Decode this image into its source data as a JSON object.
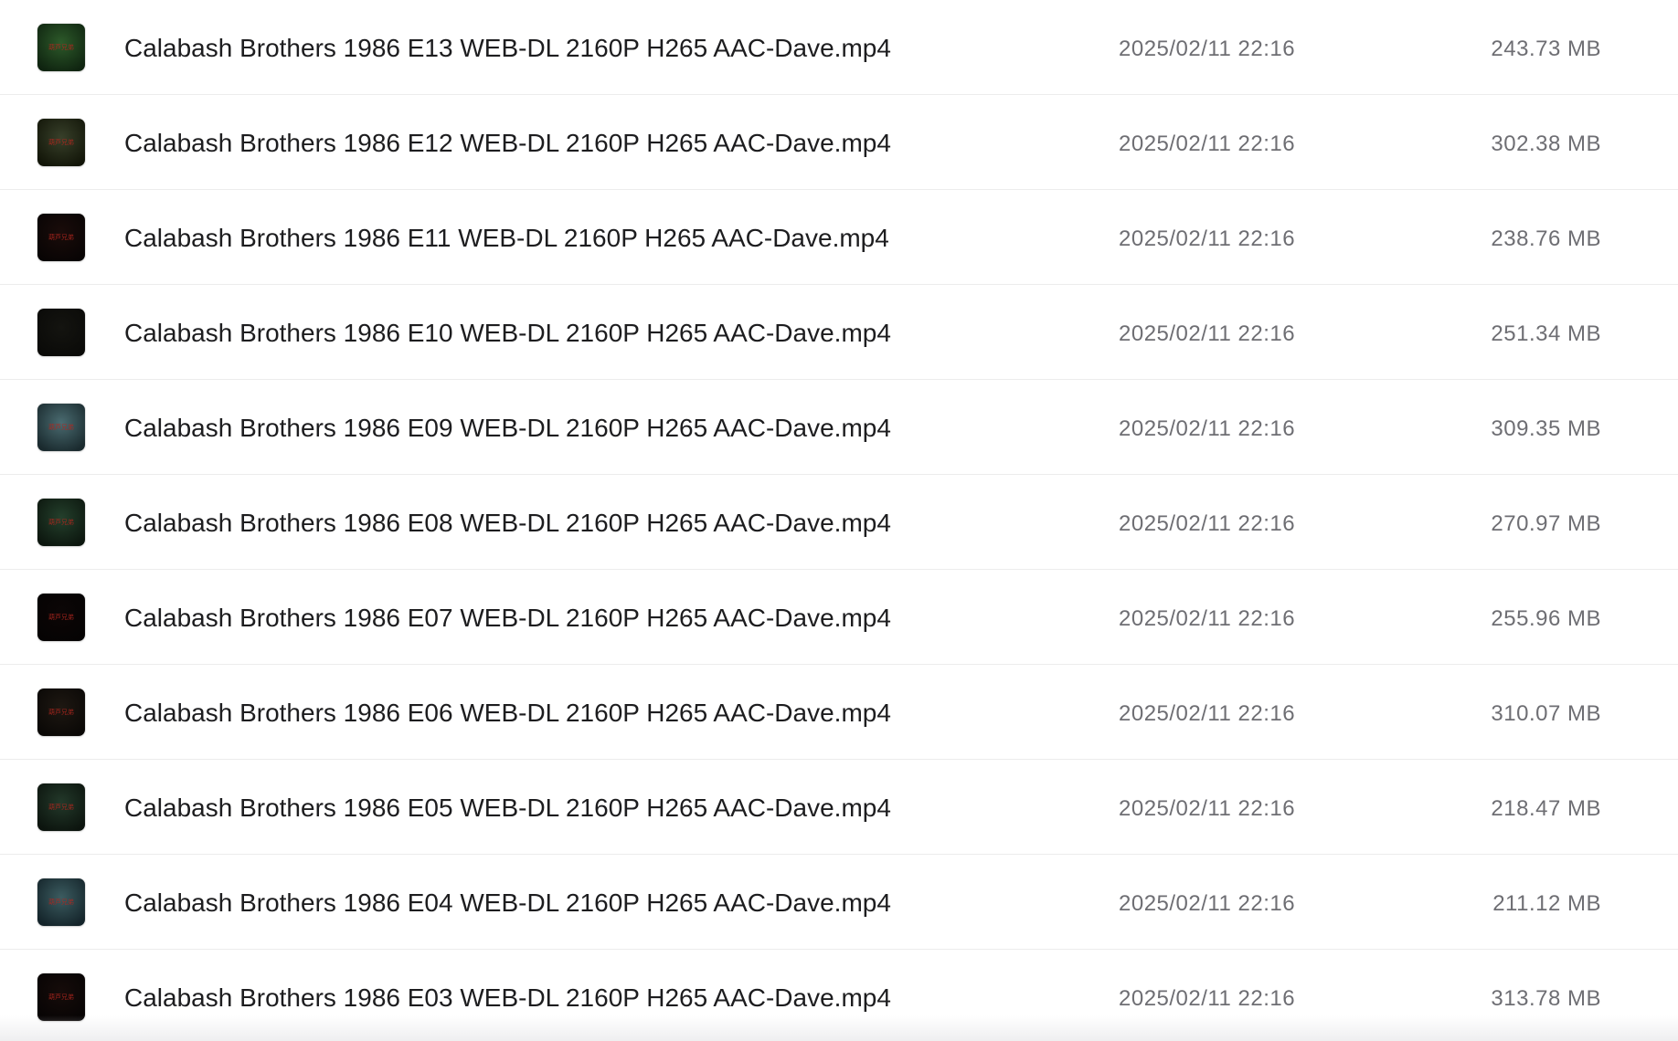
{
  "files": [
    {
      "name": "Calabash Brothers 1986 E13 WEB-DL 2160P H265 AAC-Dave.mp4",
      "date": "2025/02/11 22:16",
      "size": "243.73 MB",
      "thumb_colors": [
        "#2d5a2a",
        "#0f2410"
      ],
      "thumb_caption": "葫芦兄弟",
      "thumb_icon": "video-thumbnail-icon"
    },
    {
      "name": "Calabash Brothers 1986 E12 WEB-DL 2160P H265 AAC-Dave.mp4",
      "date": "2025/02/11 22:16",
      "size": "302.38 MB",
      "thumb_colors": [
        "#38402a",
        "#121508"
      ],
      "thumb_caption": "葫芦兄弟",
      "thumb_icon": "video-thumbnail-icon"
    },
    {
      "name": "Calabash Brothers 1986 E11 WEB-DL 2160P H265 AAC-Dave.mp4",
      "date": "2025/02/11 22:16",
      "size": "238.76 MB",
      "thumb_colors": [
        "#1a0c0a",
        "#080404"
      ],
      "thumb_caption": "葫芦兄弟",
      "thumb_icon": "video-thumbnail-icon"
    },
    {
      "name": "Calabash Brothers 1986 E10 WEB-DL 2160P H265 AAC-Dave.mp4",
      "date": "2025/02/11 22:16",
      "size": "251.34 MB",
      "thumb_colors": [
        "#141410",
        "#0a0a08"
      ],
      "thumb_caption": "",
      "thumb_icon": "video-thumbnail-icon"
    },
    {
      "name": "Calabash Brothers 1986 E09 WEB-DL 2160P H265 AAC-Dave.mp4",
      "date": "2025/02/11 22:16",
      "size": "309.35 MB",
      "thumb_colors": [
        "#4a6b70",
        "#1a2a2e"
      ],
      "thumb_caption": "葫芦兄弟",
      "thumb_icon": "video-thumbnail-icon"
    },
    {
      "name": "Calabash Brothers 1986 E08 WEB-DL 2160P H265 AAC-Dave.mp4",
      "date": "2025/02/11 22:16",
      "size": "270.97 MB",
      "thumb_colors": [
        "#24402c",
        "#0c160e"
      ],
      "thumb_caption": "葫芦兄弟",
      "thumb_icon": "video-thumbnail-icon"
    },
    {
      "name": "Calabash Brothers 1986 E07 WEB-DL 2160P H265 AAC-Dave.mp4",
      "date": "2025/02/11 22:16",
      "size": "255.96 MB",
      "thumb_colors": [
        "#0c0606",
        "#050303"
      ],
      "thumb_caption": "葫芦兄弟",
      "thumb_icon": "video-thumbnail-icon"
    },
    {
      "name": "Calabash Brothers 1986 E06 WEB-DL 2160P H265 AAC-Dave.mp4",
      "date": "2025/02/11 22:16",
      "size": "310.07 MB",
      "thumb_colors": [
        "#1e1812",
        "#0a0806"
      ],
      "thumb_caption": "葫芦兄弟",
      "thumb_icon": "video-thumbnail-icon"
    },
    {
      "name": "Calabash Brothers 1986 E05 WEB-DL 2160P H265 AAC-Dave.mp4",
      "date": "2025/02/11 22:16",
      "size": "218.47 MB",
      "thumb_colors": [
        "#23392a",
        "#0c140e"
      ],
      "thumb_caption": "葫芦兄弟",
      "thumb_icon": "video-thumbnail-icon"
    },
    {
      "name": "Calabash Brothers 1986 E04 WEB-DL 2160P H265 AAC-Dave.mp4",
      "date": "2025/02/11 22:16",
      "size": "211.12 MB",
      "thumb_colors": [
        "#3c5c60",
        "#14242a"
      ],
      "thumb_caption": "葫芦兄弟",
      "thumb_icon": "video-thumbnail-icon"
    },
    {
      "name": "Calabash Brothers 1986 E03 WEB-DL 2160P H265 AAC-Dave.mp4",
      "date": "2025/02/11 22:16",
      "size": "313.78 MB",
      "thumb_colors": [
        "#160c0a",
        "#070404"
      ],
      "thumb_caption": "葫芦兄弟",
      "thumb_icon": "video-thumbnail-icon"
    }
  ]
}
